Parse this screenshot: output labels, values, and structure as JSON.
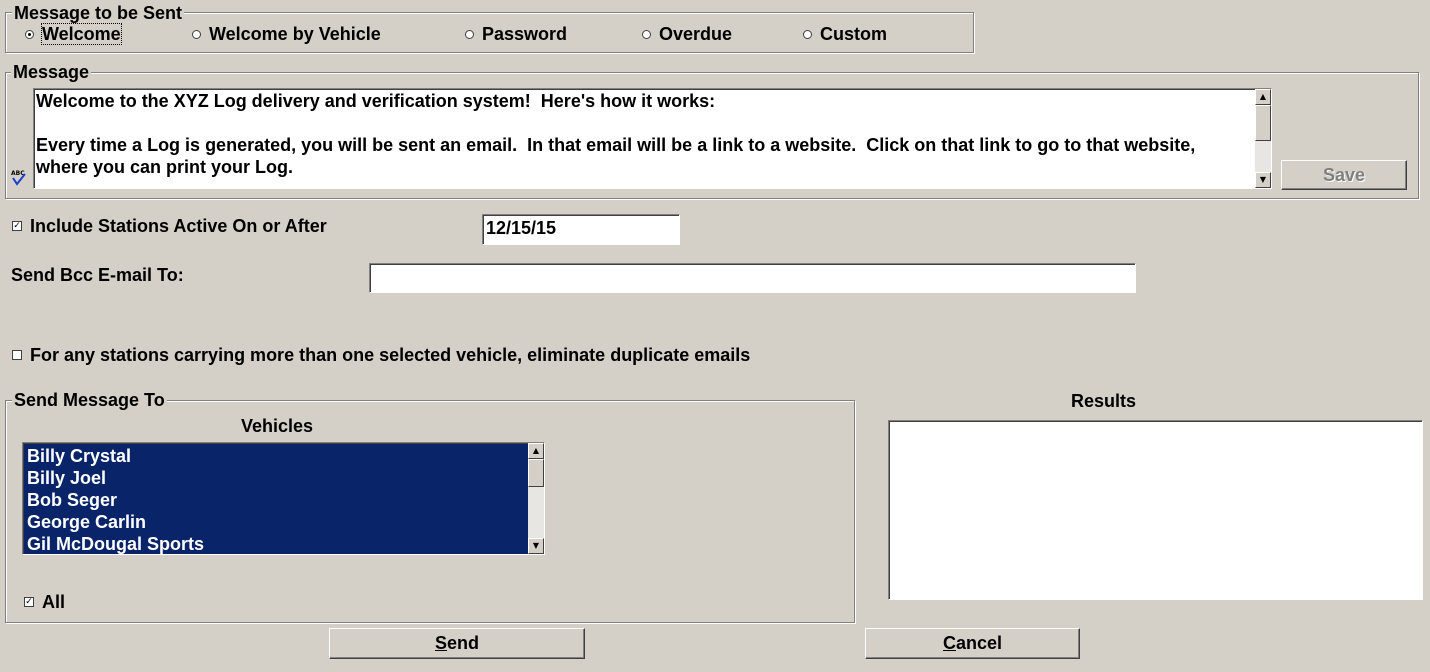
{
  "message_type_group": {
    "legend": "Message to be Sent",
    "options": [
      {
        "label": "Welcome",
        "selected": true
      },
      {
        "label": "Welcome by Vehicle",
        "selected": false
      },
      {
        "label": "Password",
        "selected": false
      },
      {
        "label": "Overdue",
        "selected": false
      },
      {
        "label": "Custom",
        "selected": false
      }
    ]
  },
  "message_group": {
    "legend": "Message",
    "text": "Welcome to the XYZ Log delivery and verification system!  Here's how it works:\n\nEvery time a Log is generated, you will be sent an email.  In that email will be a link to a website.  Click on that link to go to that website, where you can print your Log.",
    "spellcheck_icon": "abc-spellcheck-icon",
    "save_label": "Save"
  },
  "include_stations": {
    "label": "Include Stations Active On or After",
    "checked": true,
    "date_value": "12/15/15"
  },
  "bcc": {
    "label": "Send Bcc E-mail To:",
    "value": ""
  },
  "dedupe": {
    "label": "For any stations carrying more than one selected vehicle, eliminate duplicate emails",
    "checked": false
  },
  "send_to_group": {
    "legend": "Send Message To",
    "vehicles_header": "Vehicles",
    "vehicles": [
      "Billy Crystal",
      "Billy Joel",
      "Bob Seger",
      "George Carlin",
      "Gil McDougal Sports"
    ],
    "all_label": "All",
    "all_checked": true
  },
  "results": {
    "header": "Results"
  },
  "buttons": {
    "send_prefix": "S",
    "send_rest": "end",
    "cancel_prefix": "C",
    "cancel_rest": "ancel"
  },
  "colors": {
    "background": "#d4d0c8",
    "selection": "#0a246a"
  }
}
